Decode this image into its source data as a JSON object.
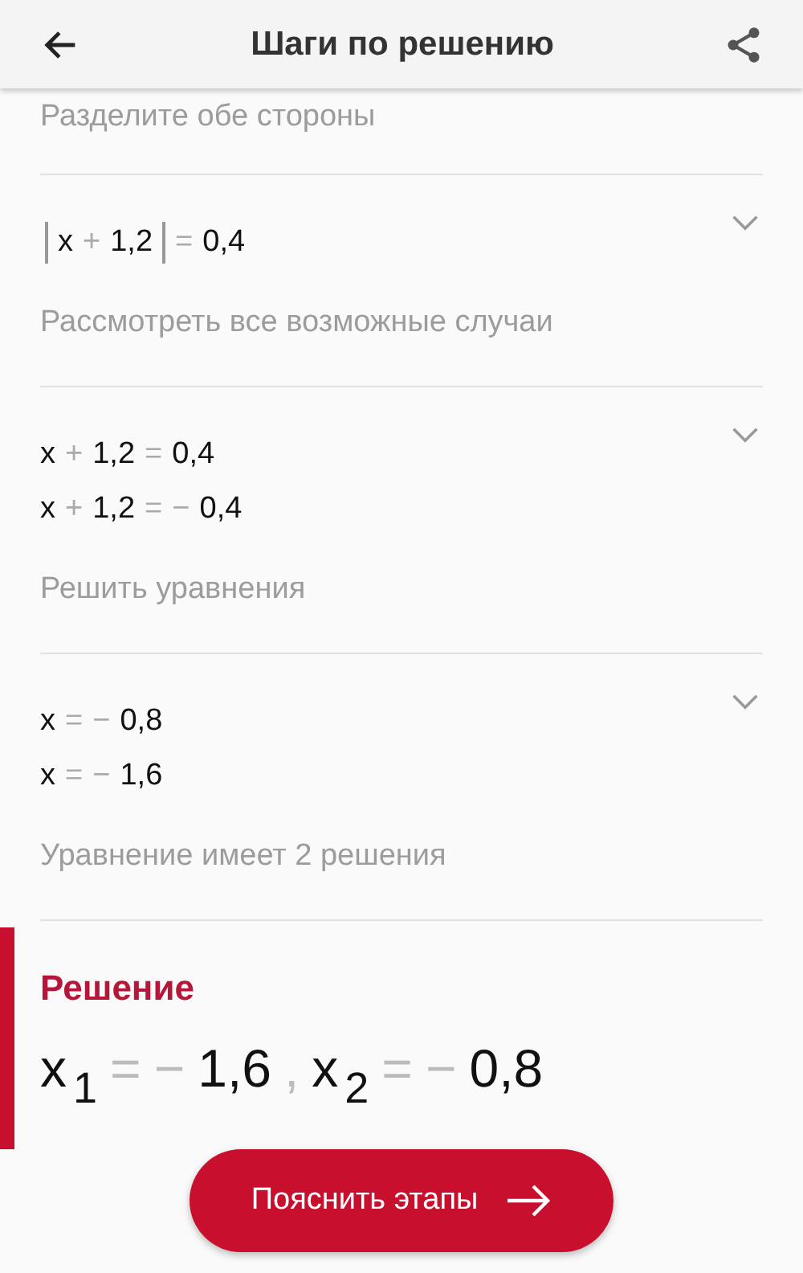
{
  "app_bar": {
    "title": "Шаги по решению"
  },
  "partial_step": {
    "description": "Разделите обе стороны"
  },
  "steps": [
    {
      "expanded": false,
      "lines": [
        [
          {
            "kind": "abs",
            "tokens": [
              {
                "kind": "term",
                "text": "x"
              },
              {
                "kind": "op",
                "text": "+"
              },
              {
                "kind": "term",
                "text": "1,2"
              }
            ]
          },
          {
            "kind": "op",
            "text": "="
          },
          {
            "kind": "term",
            "text": "0,4"
          }
        ]
      ],
      "description": "Рассмотреть все возможные случаи"
    },
    {
      "expanded": false,
      "lines": [
        [
          {
            "kind": "term",
            "text": "x"
          },
          {
            "kind": "op",
            "text": "+"
          },
          {
            "kind": "term",
            "text": "1,2"
          },
          {
            "kind": "op",
            "text": "="
          },
          {
            "kind": "term",
            "text": "0,4"
          }
        ],
        [
          {
            "kind": "term",
            "text": "x"
          },
          {
            "kind": "op",
            "text": "+"
          },
          {
            "kind": "term",
            "text": "1,2"
          },
          {
            "kind": "op",
            "text": "="
          },
          {
            "kind": "op",
            "text": "−"
          },
          {
            "kind": "term",
            "text": "0,4"
          }
        ]
      ],
      "description": "Решить уравнения"
    },
    {
      "expanded": false,
      "lines": [
        [
          {
            "kind": "term",
            "text": "x"
          },
          {
            "kind": "op",
            "text": "="
          },
          {
            "kind": "op",
            "text": "−"
          },
          {
            "kind": "term",
            "text": "0,8"
          }
        ],
        [
          {
            "kind": "term",
            "text": "x"
          },
          {
            "kind": "op",
            "text": "="
          },
          {
            "kind": "op",
            "text": "−"
          },
          {
            "kind": "term",
            "text": "1,6"
          }
        ]
      ],
      "description": "Уравнение имеет 2 решения"
    }
  ],
  "solution": {
    "title": "Решение",
    "answer": [
      {
        "kind": "term",
        "text": "x"
      },
      {
        "kind": "sub",
        "text": "1"
      },
      {
        "kind": "op",
        "text": "="
      },
      {
        "kind": "op",
        "text": "−"
      },
      {
        "kind": "term",
        "text": "1,6"
      },
      {
        "kind": "op",
        "text": ","
      },
      {
        "kind": "term",
        "text": "x"
      },
      {
        "kind": "sub",
        "text": "2"
      },
      {
        "kind": "op",
        "text": "="
      },
      {
        "kind": "op",
        "text": "−"
      },
      {
        "kind": "term",
        "text": "0,8"
      }
    ]
  },
  "explain_button": {
    "label": "Пояснить этапы"
  }
}
